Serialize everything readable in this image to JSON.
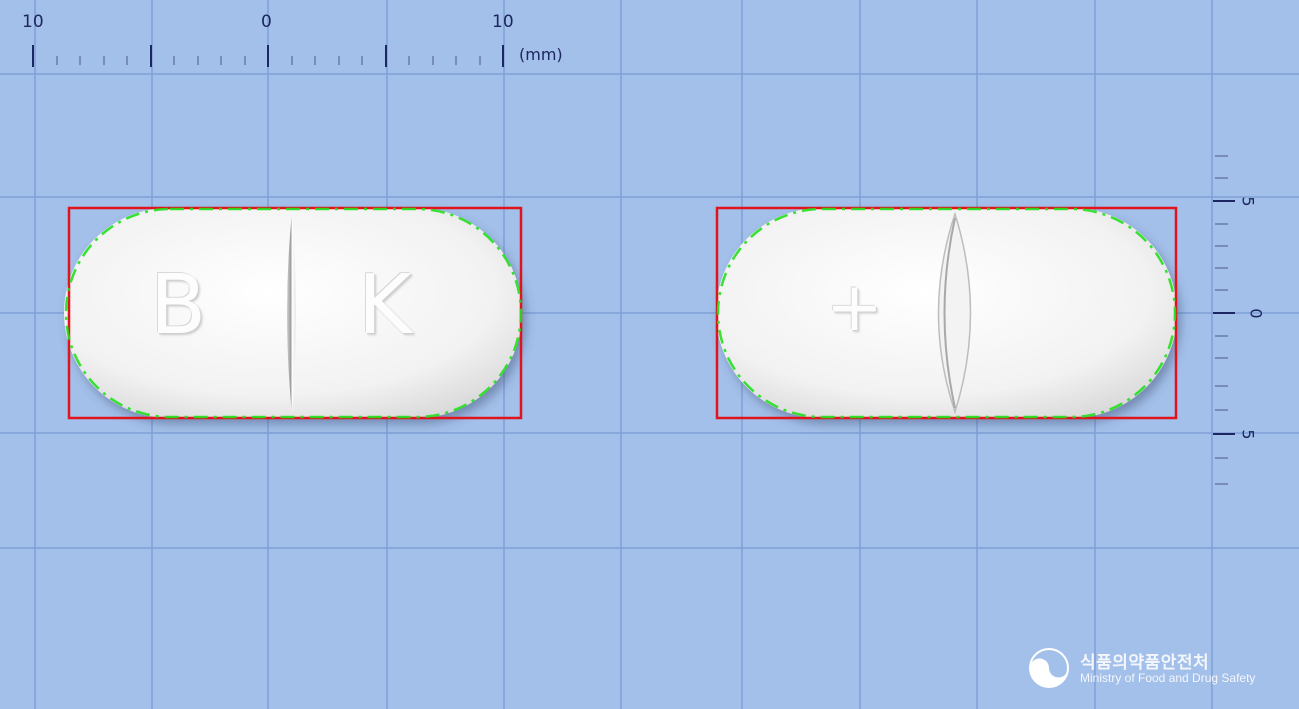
{
  "ruler": {
    "horizontal_labels": [
      "10",
      "0",
      "10"
    ],
    "unit_label": "(mm)",
    "vertical_labels": [
      "5",
      "0",
      "5"
    ]
  },
  "tablets": [
    {
      "side": "front",
      "imprint_left": "B",
      "imprint_right": "K",
      "score_line": true
    },
    {
      "side": "back",
      "imprint_left": "+",
      "imprint_right": "",
      "score_line": true
    }
  ],
  "logo": {
    "korean": "식품의약품안전처",
    "english": "Ministry of Food and Drug Safety"
  },
  "colors": {
    "background": "#a3c0ea",
    "grid": "#7f9fd6",
    "ruler": "#1c2660",
    "bounding_box": "#e0141c",
    "contour": "#22e01c",
    "tablet": "#f6f6f6"
  }
}
